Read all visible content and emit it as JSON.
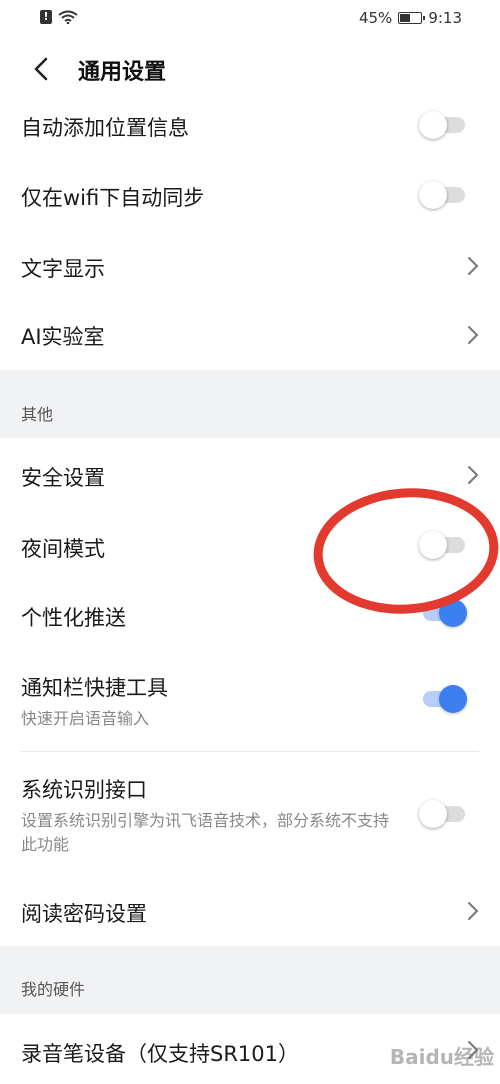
{
  "status_bar": {
    "battery": "45%",
    "battery_level": 0.45,
    "time": "9:13"
  },
  "header": {
    "title": "通用设置"
  },
  "rows": {
    "auto_location": {
      "label": "自动添加位置信息",
      "toggle": "off"
    },
    "wifi_sync": {
      "label": "仅在wifi下自动同步",
      "toggle": "off"
    },
    "text_display": {
      "label": "文字显示"
    },
    "ai_lab": {
      "label": "AI实验室"
    },
    "security": {
      "label": "安全设置"
    },
    "night_mode": {
      "label": "夜间模式",
      "toggle": "off"
    },
    "personalized_push": {
      "label": "个性化推送",
      "toggle": "on"
    },
    "notification_tools": {
      "label": "通知栏快捷工具",
      "sub": "快速开启语音输入",
      "toggle": "on"
    },
    "system_recognition": {
      "label": "系统识别接口",
      "sub": "设置系统识别引擎为讯飞语音技术，部分系统不支持此功能",
      "toggle": "off"
    },
    "reading_password": {
      "label": "阅读密码设置"
    },
    "recorder_device": {
      "label": "录音笔设备（仅支持SR101）"
    }
  },
  "sections": {
    "other": "其他",
    "my_hardware": "我的硬件"
  },
  "watermark": "Baidu经验",
  "colors": {
    "accent": "#3c7ff0",
    "annotation": "#e23a2f"
  }
}
